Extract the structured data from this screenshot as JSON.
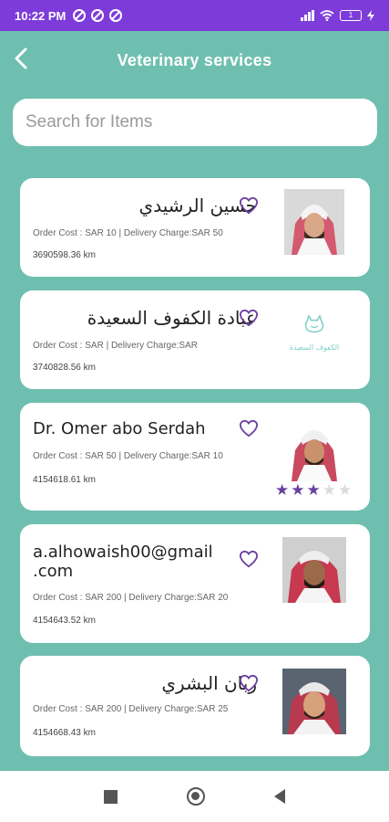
{
  "status": {
    "time": "10:22 PM",
    "battery": "1"
  },
  "header": {
    "title": "Veterinary services"
  },
  "search": {
    "placeholder": "Search for Items"
  },
  "providers": [
    {
      "name": "حسين الرشيدي",
      "cost": "Order Cost : SAR 10 | Delivery Charge:SAR 50",
      "distance": "3690598.36 km"
    },
    {
      "name": "عبادة الكفوف السعيدة",
      "cost": "Order Cost : SAR  | Delivery Charge:SAR",
      "distance": "3740828.56 km",
      "logo_text": "الكفوف السعيدة"
    },
    {
      "name": "Dr. Omer abo Serdah",
      "cost": "Order Cost : SAR 50 | Delivery Charge:SAR 10",
      "distance": "4154618.61 km",
      "rating": 3,
      "rating_max": 5
    },
    {
      "name_line1": "a.alhowaish00@gmail",
      "name_line2": ".com",
      "cost": "Order Cost : SAR 200 | Delivery Charge:SAR 20",
      "distance": "4154643.52 km"
    },
    {
      "name": "ربان البشري",
      "cost": "Order Cost : SAR 200 | Delivery Charge:SAR 25",
      "distance": "4154668.43 km"
    }
  ],
  "colors": {
    "status_bar": "#7d3cd9",
    "background": "#6fbfb0",
    "accent": "#6a3fa0",
    "star_on": "#6a3fa0",
    "star_off": "#dcdcdc"
  },
  "icons": {
    "back": "back-arrow-icon",
    "favorite": "heart-outline-icon",
    "nav_recents": "square-icon",
    "nav_home": "circle-icon",
    "nav_back": "triangle-back-icon"
  }
}
